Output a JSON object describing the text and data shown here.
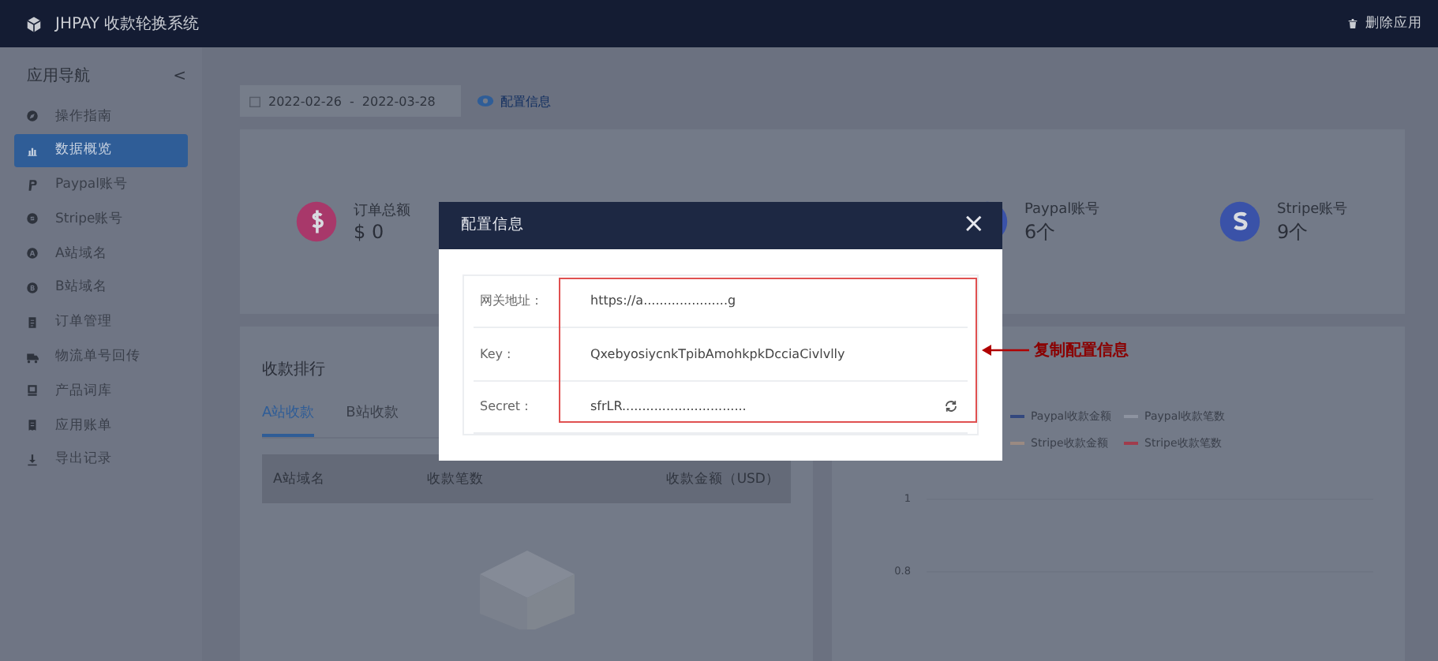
{
  "header": {
    "title": "JHPAY 收款轮换系统",
    "action": "删除应用"
  },
  "sidebar": {
    "title": "应用导航",
    "collapse": "<",
    "items": [
      {
        "label": "操作指南",
        "selected": false
      },
      {
        "label": "数据概览",
        "selected": true
      },
      {
        "label": "Paypal账号",
        "selected": false
      },
      {
        "label": "Stripe账号",
        "selected": false
      },
      {
        "label": "A站域名",
        "selected": false
      },
      {
        "label": "B站域名",
        "selected": false
      },
      {
        "label": "订单管理",
        "selected": false
      },
      {
        "label": "物流单号回传",
        "selected": false
      },
      {
        "label": "产品词库",
        "selected": false
      },
      {
        "label": "应用账单",
        "selected": false
      },
      {
        "label": "导出记录",
        "selected": false
      }
    ]
  },
  "filter": {
    "date_start": "2022-02-26",
    "separator": "-",
    "date_end": "2022-03-28",
    "config_link": "配置信息"
  },
  "stats": [
    {
      "label": "订单总额",
      "value": "$ 0",
      "color": "#a8386a"
    },
    {
      "label": "Paypal账号",
      "value": "6个",
      "color": "#3a52a8"
    },
    {
      "label": "Stripe账号",
      "value": "9个",
      "color": "#3a52a8"
    }
  ],
  "ranking": {
    "title": "收款排行",
    "tabs": [
      {
        "label": "A站收款",
        "selected": true
      },
      {
        "label": "B站收款",
        "selected": false
      }
    ],
    "columns": [
      "A站域名",
      "收款笔数",
      "收款金额（USD）"
    ]
  },
  "chart": {
    "legend": [
      {
        "label": "Paypal收款金额",
        "color": "#33487e"
      },
      {
        "label": "Paypal收款笔数",
        "color": "#8d93a0"
      },
      {
        "label": "Stripe收款金额",
        "color": "#9a8a82"
      },
      {
        "label": "Stripe收款笔数",
        "color": "#a03c4c"
      }
    ],
    "y_labels": [
      "1",
      "0.8"
    ]
  },
  "modal": {
    "title": "配置信息",
    "close": "×",
    "fields": [
      {
        "label": "网关地址：",
        "value": "https://a.....................g",
        "kind": "text"
      },
      {
        "label": "Key :",
        "value": "QxebyosiycnkTpibAmohkpkDcciaCivlvlly",
        "kind": "text"
      },
      {
        "label": "Secret :",
        "value": "sfrLR...............................",
        "kind": "secret"
      }
    ]
  },
  "annotation": {
    "text": "复制配置信息"
  }
}
